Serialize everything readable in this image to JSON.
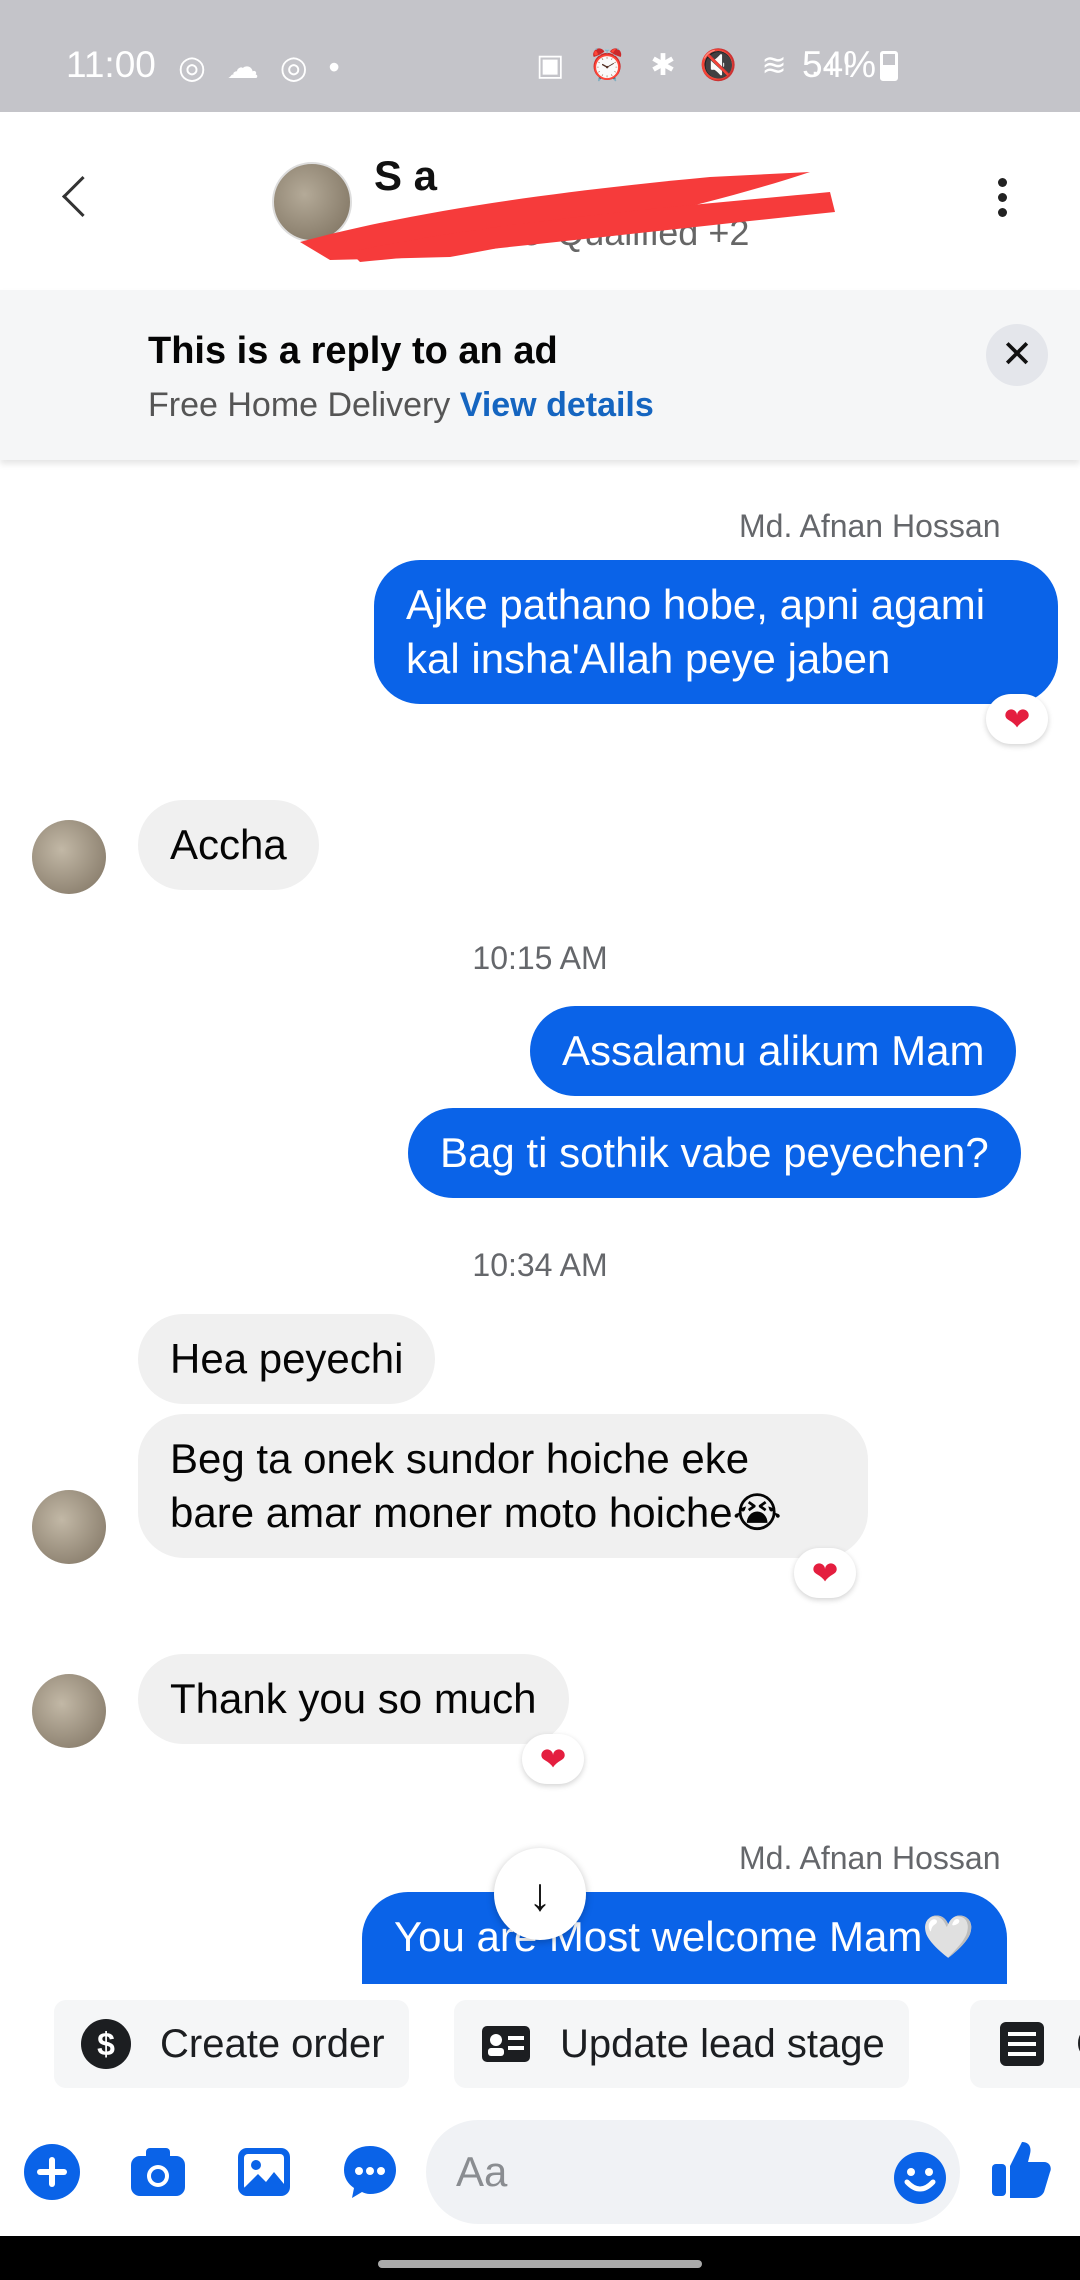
{
  "status_bar": {
    "time": "11:00",
    "left_icons": "◎ ☁ ◎ •",
    "right_icons": "▣ ⏰ ✱ 🔇 ≋ .ıl",
    "battery": "54%"
  },
  "header": {
    "contact_name": "S                  a",
    "lead_stages": "Intake  ⊗ Qualified +2",
    "back_icon": "chevron-left",
    "more_icon": "vertical-dots"
  },
  "ad_banner": {
    "title": "This is a reply to an ad",
    "subtitle": "Free Home Delivery",
    "link": "View details",
    "close": "✕"
  },
  "messages": {
    "sender_1": "Md. Afnan Hossan",
    "out_1": "Ajke pathano hobe, apni agami kal insha'Allah peye jaben",
    "reaction_1": "❤",
    "in_1": "Accha",
    "time_1": "10:15 AM",
    "out_2": "Assalamu alikum Mam",
    "out_3": "Bag ti sothik vabe peyechen?",
    "time_2": "10:34 AM",
    "in_2": "Hea peyechi",
    "in_3": "Beg ta onek sundor hoiche eke bare amar moner moto hoiche😭",
    "reaction_2": "❤",
    "in_4": "Thank you so much",
    "reaction_3": "❤",
    "sender_2": "Md. Afnan Hossan",
    "out_4": "You are Most welcome Mam🤍",
    "scroll_down": "↓"
  },
  "quick_actions": {
    "create_order": "Create order",
    "update_lead_stage": "Update lead stage",
    "third_partial": "C"
  },
  "composer": {
    "placeholder": "Aa"
  },
  "colors": {
    "accent": "#0a63e8",
    "incoming_bubble": "#f0f0f0",
    "status_bar": "#c4c4c9",
    "reaction": "#e41e3f"
  }
}
